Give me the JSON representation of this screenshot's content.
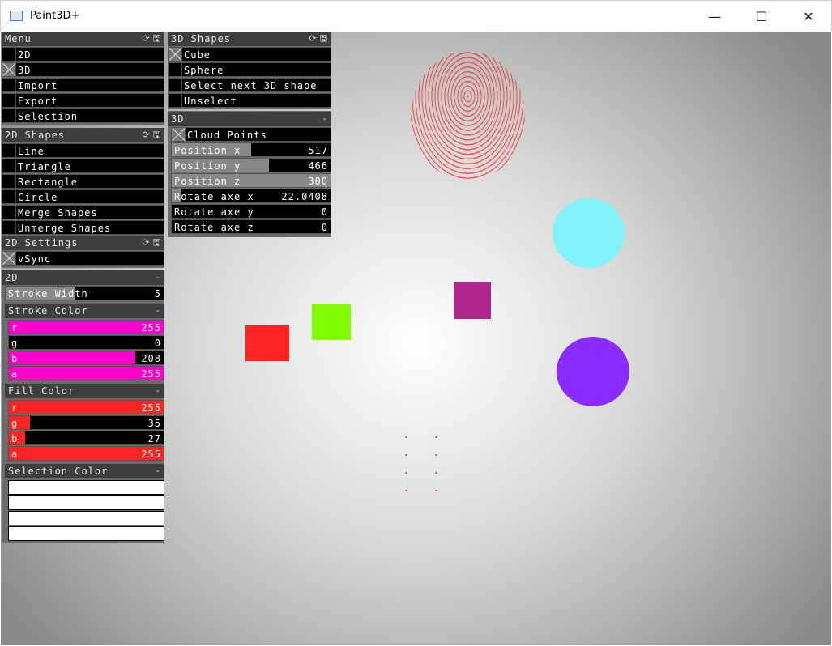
{
  "window": {
    "title": "Paint3D+",
    "minimize": "—",
    "maximize": "☐",
    "close": "✕"
  },
  "menu": {
    "title": "Menu",
    "items": [
      {
        "label": "2D",
        "checked": false
      },
      {
        "label": "3D",
        "checked": true
      },
      {
        "label": "Import",
        "checked": false
      },
      {
        "label": "Export",
        "checked": false
      },
      {
        "label": "Selection",
        "checked": false
      }
    ]
  },
  "shapes2d": {
    "title": "2D Shapes",
    "items": [
      {
        "label": "Line",
        "checked": false
      },
      {
        "label": "Triangle",
        "checked": false
      },
      {
        "label": "Rectangle",
        "checked": false
      },
      {
        "label": "Circle",
        "checked": false
      },
      {
        "label": "Merge Shapes",
        "checked": false
      },
      {
        "label": "Unmerge Shapes",
        "checked": false
      }
    ]
  },
  "settings2d": {
    "title": "2D Settings",
    "items": [
      {
        "label": "vSync",
        "checked": true
      }
    ]
  },
  "panel2d": {
    "title": "2D",
    "collapse": "-",
    "stroke_width": {
      "label": "Stroke Width",
      "value": "5",
      "fraction": 0.44
    },
    "stroke_color": {
      "title": "Stroke Color",
      "collapse": "-",
      "color": "#ff00cc",
      "channels": [
        {
          "label": "r",
          "value": "255"
        },
        {
          "label": "g",
          "value": "0"
        },
        {
          "label": "b",
          "value": "208"
        },
        {
          "label": "a",
          "value": "255"
        }
      ]
    },
    "fill_color": {
      "title": "Fill Color",
      "collapse": "-",
      "color": "#ff2323",
      "channels": [
        {
          "label": "r",
          "value": "255"
        },
        {
          "label": "g",
          "value": "35"
        },
        {
          "label": "b",
          "value": "27"
        },
        {
          "label": "a",
          "value": "255"
        }
      ]
    },
    "selection_color": {
      "title": "Selection Color",
      "collapse": "-"
    }
  },
  "shapes3d": {
    "title": "3D Shapes",
    "items": [
      {
        "label": "Cube",
        "checked": true
      },
      {
        "label": "Sphere",
        "checked": false
      },
      {
        "label": "Select next 3D shape",
        "checked": false
      },
      {
        "label": "Unselect",
        "checked": false
      }
    ]
  },
  "panel3d": {
    "title": "3D",
    "collapse": "-",
    "cloud_points": {
      "label": "Cloud Points",
      "checked": true
    },
    "sliders": [
      {
        "label": "Position x",
        "value": "517",
        "fraction": 0.5
      },
      {
        "label": "Position y",
        "value": "466",
        "fraction": 0.61
      },
      {
        "label": "Position z",
        "value": "300",
        "fraction": 1
      },
      {
        "label": "Rotate axe x",
        "value": "22.0408",
        "fraction": 0.06
      },
      {
        "label": "Rotate axe y",
        "value": "0",
        "fraction": 0
      },
      {
        "label": "Rotate axe z",
        "value": "0",
        "fraction": 0
      }
    ]
  },
  "header_icons": [
    "refresh-icon",
    "save-icon"
  ],
  "scene_colors": {
    "cyan": "#80f4fa",
    "purple": "#8a2bff",
    "magenta": "#b0268c",
    "green": "#80ff00",
    "red": "#ff2323",
    "cloud": "#ff2020"
  }
}
